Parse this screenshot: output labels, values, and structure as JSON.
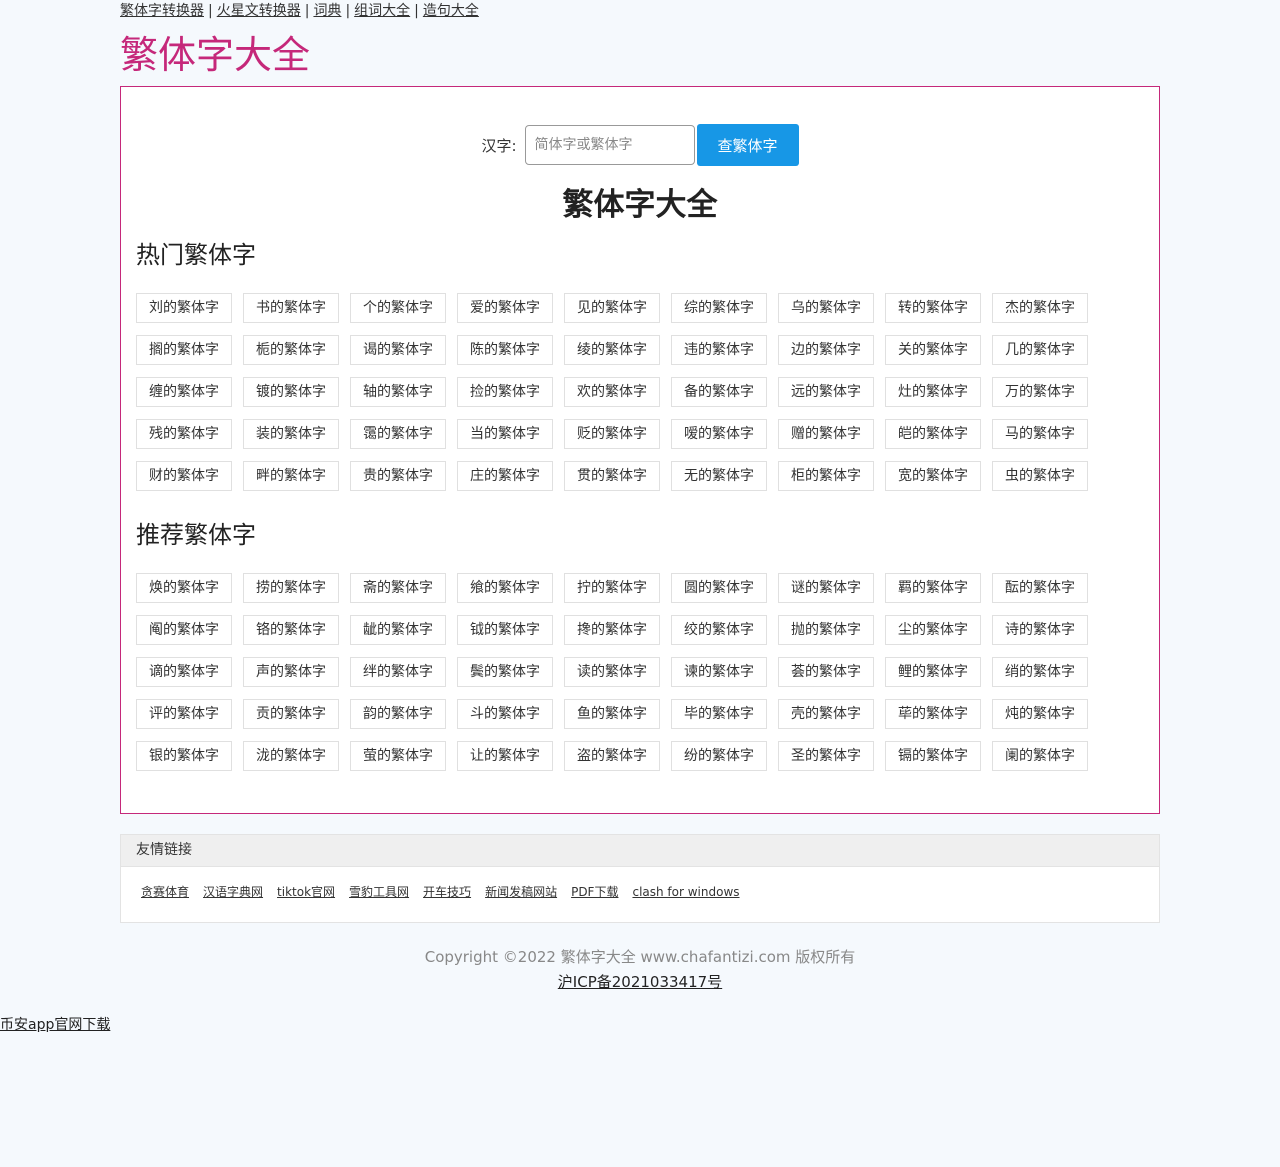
{
  "top_nav": [
    {
      "label": "繁体字转换器"
    },
    {
      "label": "火星文转换器"
    },
    {
      "label": "词典"
    },
    {
      "label": "组词大全"
    },
    {
      "label": "造句大全"
    }
  ],
  "site_title": "繁体字大全",
  "search": {
    "label": "汉字:",
    "placeholder": "简体字或繁体字",
    "button": "查繁体字"
  },
  "page_heading": "繁体字大全",
  "hot_section": {
    "title": "热门繁体字",
    "items": [
      "刘的繁体字",
      "书的繁体字",
      "个的繁体字",
      "爱的繁体字",
      "见的繁体字",
      "综的繁体字",
      "乌的繁体字",
      "转的繁体字",
      "杰的繁体字",
      "搁的繁体字",
      "栀的繁体字",
      "谒的繁体字",
      "陈的繁体字",
      "绫的繁体字",
      "违的繁体字",
      "边的繁体字",
      "关的繁体字",
      "几的繁体字",
      "缠的繁体字",
      "镀的繁体字",
      "轴的繁体字",
      "捡的繁体字",
      "欢的繁体字",
      "备的繁体字",
      "远的繁体字",
      "灶的繁体字",
      "万的繁体字",
      "残的繁体字",
      "装的繁体字",
      "霭的繁体字",
      "当的繁体字",
      "贬的繁体字",
      "嗳的繁体字",
      "赠的繁体字",
      "皑的繁体字",
      "马的繁体字",
      "财的繁体字",
      "畔的繁体字",
      "贵的繁体字",
      "庄的繁体字",
      "贯的繁体字",
      "无的繁体字",
      "柜的繁体字",
      "宽的繁体字",
      "虫的繁体字"
    ]
  },
  "rec_section": {
    "title": "推荐繁体字",
    "items": [
      "焕的繁体字",
      "捞的繁体字",
      "斋的繁体字",
      "飨的繁体字",
      "拧的繁体字",
      "圆的繁体字",
      "谜的繁体字",
      "羁的繁体字",
      "酝的繁体字",
      "阄的繁体字",
      "铬的繁体字",
      "龇的繁体字",
      "钺的繁体字",
      "搀的繁体字",
      "绞的繁体字",
      "抛的繁体字",
      "尘的繁体字",
      "诗的繁体字",
      "谪的繁体字",
      "声的繁体字",
      "绊的繁体字",
      "鬓的繁体字",
      "读的繁体字",
      "谏的繁体字",
      "荟的繁体字",
      "鲤的繁体字",
      "绡的繁体字",
      "评的繁体字",
      "贡的繁体字",
      "韵的繁体字",
      "斗的繁体字",
      "鱼的繁体字",
      "毕的繁体字",
      "壳的繁体字",
      "荜的繁体字",
      "炖的繁体字",
      "银的繁体字",
      "泷的繁体字",
      "萤的繁体字",
      "让的繁体字",
      "盗的繁体字",
      "纷的繁体字",
      "圣的繁体字",
      "镉的繁体字",
      "阑的繁体字"
    ]
  },
  "friend_links": {
    "title": "友情链接",
    "items": [
      "贪赛体育",
      "汉语字典网",
      "tiktok官网",
      "雪豹工具网",
      "开车技巧",
      "新闻发稿网站",
      "PDF下载",
      "clash for windows"
    ]
  },
  "footer": {
    "copyright": "Copyright ©2022 繁体字大全 www.chafantizi.com 版权所有",
    "icp": "沪ICP备2021033417号"
  },
  "bottom_link": "币安app官网下载",
  "colors": {
    "accent": "#c5287a",
    "button": "#1797e6",
    "background": "#f5f9fd"
  }
}
